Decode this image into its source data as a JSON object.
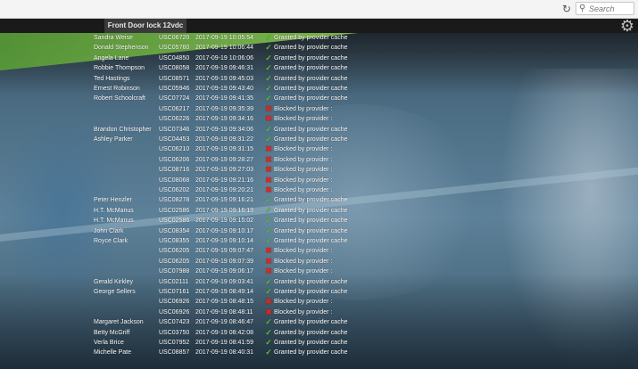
{
  "browser": {
    "search_placeholder": "Search",
    "refresh_glyph": "↻",
    "search_glyph": "🔍"
  },
  "app": {
    "tab_title": "Front Door lock 12vdc",
    "settings_glyph": "⚙"
  },
  "colors": {
    "granted": "#5ec23b",
    "blocked": "#e0261d",
    "band": "#7fc14a"
  },
  "icons": {
    "granted": "check-icon",
    "blocked": "x-icon"
  },
  "rows": [
    {
      "name": "Sandra Weise",
      "id": "USC06720",
      "time": "2017-09-19 10:05:54",
      "result": "granted",
      "status": "Granted by provider cache"
    },
    {
      "name": "Donald Stephenson",
      "id": "USC05760",
      "time": "2017-09-19 10:06:44",
      "result": "granted",
      "status": "Granted by provider cache"
    },
    {
      "name": "Angela Lane",
      "id": "USC04850",
      "time": "2017-09-19 10:06:06",
      "result": "granted",
      "status": "Granted by provider cache"
    },
    {
      "name": "Robbie Thompson",
      "id": "USC08058",
      "time": "2017-09-19 09:46:31",
      "result": "granted",
      "status": "Granted by provider cache"
    },
    {
      "name": "Ted Hastings",
      "id": "USC08571",
      "time": "2017-09-19 09:45:03",
      "result": "granted",
      "status": "Granted by provider cache"
    },
    {
      "name": "Ernest Robinson",
      "id": "USC05946",
      "time": "2017-09-19 09:43:40",
      "result": "granted",
      "status": "Granted by provider cache"
    },
    {
      "name": "Robert Schoolcraft",
      "id": "USC07724",
      "time": "2017-09-19 09:41:35",
      "result": "granted",
      "status": "Granted by provider cache"
    },
    {
      "name": "",
      "id": "USC06217",
      "time": "2017-09-19 09:35:39",
      "result": "blocked",
      "status": "Blocked by provider :"
    },
    {
      "name": "",
      "id": "USC06226",
      "time": "2017-09-19 09:34:16",
      "result": "blocked",
      "status": "Blocked by provider :"
    },
    {
      "name": "Brandon Christopher",
      "id": "USC07346",
      "time": "2017-09-19 09:34:06",
      "result": "granted",
      "status": "Granted by provider cache"
    },
    {
      "name": "Ashley Parker",
      "id": "USC04453",
      "time": "2017-09-19 09:31:22",
      "result": "granted",
      "status": "Granted by provider cache"
    },
    {
      "name": "",
      "id": "USC06210",
      "time": "2017-09-19 09:31:15",
      "result": "blocked",
      "status": "Blocked by provider :"
    },
    {
      "name": "",
      "id": "USC06206",
      "time": "2017-09-19 09:28:27",
      "result": "blocked",
      "status": "Blocked by provider :"
    },
    {
      "name": "",
      "id": "USC08716",
      "time": "2017-09-19 09:27:03",
      "result": "blocked",
      "status": "Blocked by provider :"
    },
    {
      "name": "",
      "id": "USC08068",
      "time": "2017-09-19 09:21:16",
      "result": "blocked",
      "status": "Blocked by provider :"
    },
    {
      "name": "",
      "id": "USC06202",
      "time": "2017-09-19 09:20:21",
      "result": "blocked",
      "status": "Blocked by provider :"
    },
    {
      "name": "Peter Henzler",
      "id": "USC08278",
      "time": "2017-09-19 09:16:21",
      "result": "granted",
      "status": "Granted by provider cache"
    },
    {
      "name": "H.T. McManus",
      "id": "USC02586",
      "time": "2017-09-19 09:16:13",
      "result": "granted",
      "status": "Granted by provider cache"
    },
    {
      "name": "H.T. McManus",
      "id": "USC02586",
      "time": "2017-09-19 09:15:02",
      "result": "granted",
      "status": "Granted by provider cache"
    },
    {
      "name": "John Clark",
      "id": "USC08354",
      "time": "2017-09-19 09:10:17",
      "result": "granted",
      "status": "Granted by provider cache"
    },
    {
      "name": "Royce Clark",
      "id": "USC08355",
      "time": "2017-09-19 09:10:14",
      "result": "granted",
      "status": "Granted by provider cache"
    },
    {
      "name": "",
      "id": "USC06205",
      "time": "2017-09-19 09:07:47",
      "result": "blocked",
      "status": "Blocked by provider :"
    },
    {
      "name": "",
      "id": "USC06205",
      "time": "2017-09-19 09:07:39",
      "result": "blocked",
      "status": "Blocked by provider :"
    },
    {
      "name": "",
      "id": "USC07988",
      "time": "2017-09-19 09:06:17",
      "result": "blocked",
      "status": "Blocked by provider :"
    },
    {
      "name": "Gerald Kirkley",
      "id": "USC02111",
      "time": "2017-09-19 09:03:41",
      "result": "granted",
      "status": "Granted by provider cache"
    },
    {
      "name": "George Sellers",
      "id": "USC07161",
      "time": "2017-09-19 08:49:14",
      "result": "granted",
      "status": "Granted by provider cache"
    },
    {
      "name": "",
      "id": "USC06926",
      "time": "2017-09-19 08:48:15",
      "result": "blocked",
      "status": "Blocked by provider :"
    },
    {
      "name": "",
      "id": "USC06926",
      "time": "2017-09-19 08:48:11",
      "result": "blocked",
      "status": "Blocked by provider :"
    },
    {
      "name": "Margaret Jackson",
      "id": "USC07423",
      "time": "2017-09-19 08:46:47",
      "result": "granted",
      "status": "Granted by provider cache"
    },
    {
      "name": "Betty McGriff",
      "id": "USC03750",
      "time": "2017-09-19 08:42:08",
      "result": "granted",
      "status": "Granted by provider cache"
    },
    {
      "name": "Verla Brice",
      "id": "USC07952",
      "time": "2017-09-19 08:41:59",
      "result": "granted",
      "status": "Granted by provider cache"
    },
    {
      "name": "Michelle Pate",
      "id": "USC08857",
      "time": "2017-09-19 08:40:31",
      "result": "granted",
      "status": "Granted by provider cache"
    }
  ]
}
